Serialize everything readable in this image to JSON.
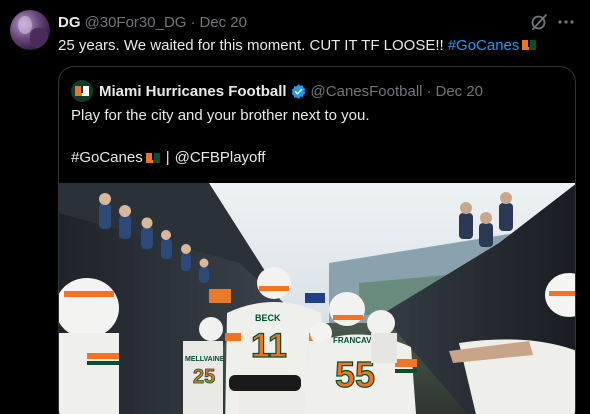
{
  "tweet": {
    "author_name": "DG",
    "author_handle": "@30For30_DG",
    "separator": "·",
    "time": "Dec 20",
    "text": "25 years. We waited for this moment. CUT IT TF LOOSE!!",
    "hashtag": "#GoCanes",
    "avatar_icon": "user-avatar",
    "grok_icon": "grok-icon",
    "more_icon": "more-icon"
  },
  "quote": {
    "author_name": "Miami Hurricanes Football",
    "author_handle": "@CanesFootball",
    "separator": "·",
    "time": "Dec 20",
    "line1": "Play for the city and your brother next to you.",
    "hashtag": "#GoCanes",
    "divider": "|",
    "mention": "@CFBPlayoff",
    "verified_icon": "verified-badge-icon",
    "media": {
      "jersey_numbers": [
        "11",
        "55",
        "25"
      ],
      "jersey_names": [
        "BECK",
        "FRANCAVILLA",
        "MELLVAINE"
      ]
    }
  },
  "colors": {
    "background": "#000000",
    "text": "#e7e9ea",
    "muted": "#71767b",
    "link": "#1d9bf0",
    "border": "#2f3336",
    "canes_orange": "#f47321",
    "canes_green": "#005030"
  }
}
